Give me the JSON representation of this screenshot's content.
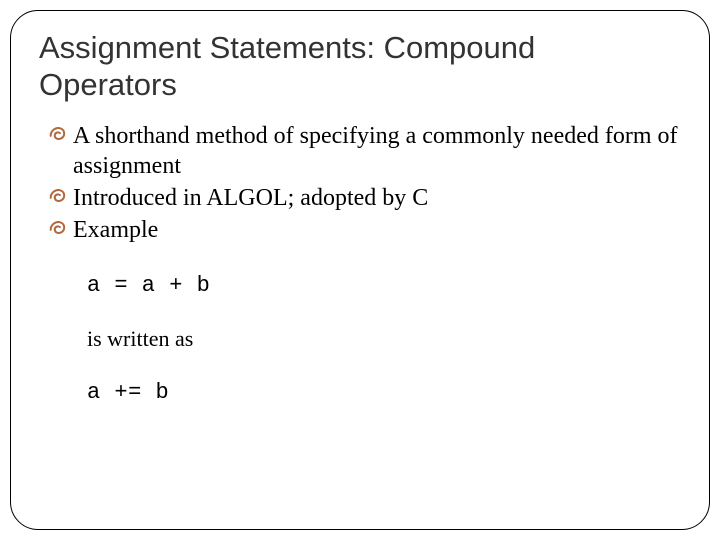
{
  "title": "Assignment Statements: Compound Operators",
  "bullets": [
    "A shorthand method of specifying a commonly needed form of assignment",
    "Introduced in ALGOL; adopted by C",
    "Example"
  ],
  "example": {
    "code1": "a = a + b",
    "label": "is written as",
    "code2": "a += b"
  },
  "bullet_color": "#b06a3c"
}
